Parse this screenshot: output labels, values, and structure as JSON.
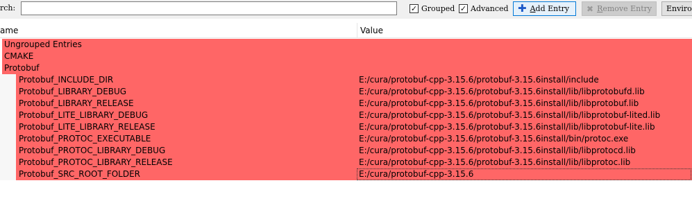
{
  "toolbar": {
    "search_label": "rch:",
    "search_value": "",
    "grouped": {
      "label": "Grouped",
      "checked": true
    },
    "advanced": {
      "label": "Advanced",
      "checked": true
    },
    "add_entry": {
      "label_first": "A",
      "label_rest": "dd Entry",
      "icon": "plus-icon"
    },
    "remove_entry": {
      "label_first": "R",
      "label_rest": "emove Entry",
      "icon": "x-icon"
    },
    "environment": {
      "label": "Enviror"
    }
  },
  "table": {
    "columns": [
      "ame",
      "Value"
    ],
    "groups": [
      "Ungrouped Entries",
      "CMAKE",
      "Protobuf"
    ],
    "entries": [
      {
        "name": "Protobuf_INCLUDE_DIR",
        "value": "E:/cura/protobuf-cpp-3.15.6/protobuf-3.15.6install/include"
      },
      {
        "name": "Protobuf_LIBRARY_DEBUG",
        "value": "E:/cura/protobuf-cpp-3.15.6/protobuf-3.15.6install/lib/libprotobufd.lib"
      },
      {
        "name": "Protobuf_LIBRARY_RELEASE",
        "value": "E:/cura/protobuf-cpp-3.15.6/protobuf-3.15.6install/lib/libprotobuf.lib"
      },
      {
        "name": "Protobuf_LITE_LIBRARY_DEBUG",
        "value": "E:/cura/protobuf-cpp-3.15.6/protobuf-3.15.6install/lib/libprotobuf-lited.lib"
      },
      {
        "name": "Protobuf_LITE_LIBRARY_RELEASE",
        "value": "E:/cura/protobuf-cpp-3.15.6/protobuf-3.15.6install/lib/libprotobuf-lite.lib"
      },
      {
        "name": "Protobuf_PROTOC_EXECUTABLE",
        "value": "E:/cura/protobuf-cpp-3.15.6/protobuf-3.15.6install/bin/protoc.exe"
      },
      {
        "name": "Protobuf_PROTOC_LIBRARY_DEBUG",
        "value": "E:/cura/protobuf-cpp-3.15.6/protobuf-3.15.6install/lib/libprotocd.lib"
      },
      {
        "name": "Protobuf_PROTOC_LIBRARY_RELEASE",
        "value": "E:/cura/protobuf-cpp-3.15.6/protobuf-3.15.6install/lib/libprotoc.lib"
      },
      {
        "name": "Protobuf_SRC_ROOT_FOLDER",
        "value": "E:/cura/protobuf-cpp-3.15.6"
      }
    ]
  },
  "colors": {
    "new_entry_highlight": "#ff6666",
    "accent_border": "#0078d7"
  }
}
